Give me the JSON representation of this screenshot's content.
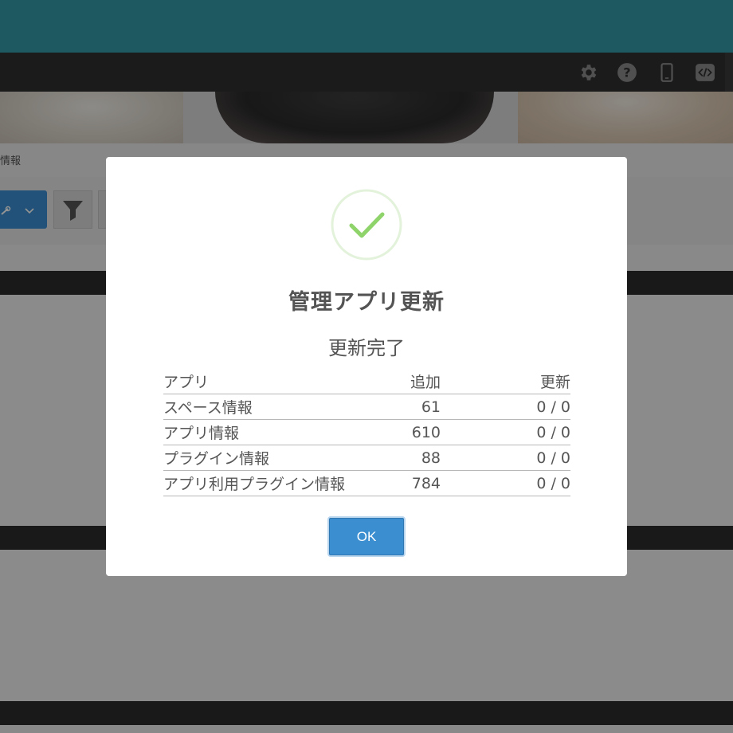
{
  "header": {
    "icons": [
      "gear-icon",
      "help-icon",
      "mobile-icon",
      "code-icon"
    ]
  },
  "breadcrumb": "情報",
  "modal": {
    "title": "管理アプリ更新",
    "subtitle": "更新完了",
    "table": {
      "columns": [
        "アプリ",
        "追加",
        "更新"
      ],
      "rows": [
        {
          "name": "スペース情報",
          "added": "61",
          "updated": "0 / 0"
        },
        {
          "name": "アプリ情報",
          "added": "610",
          "updated": "0 / 0"
        },
        {
          "name": "プラグイン情報",
          "added": "88",
          "updated": "0 / 0"
        },
        {
          "name": "アプリ利用プラグイン情報",
          "added": "784",
          "updated": "0 / 0"
        }
      ]
    },
    "ok_label": "OK",
    "colors": {
      "accent": "#3b8ed0",
      "success": "#8fd36b",
      "header_bg": "#2f2f2f",
      "top_bar": "#3498a8"
    }
  }
}
